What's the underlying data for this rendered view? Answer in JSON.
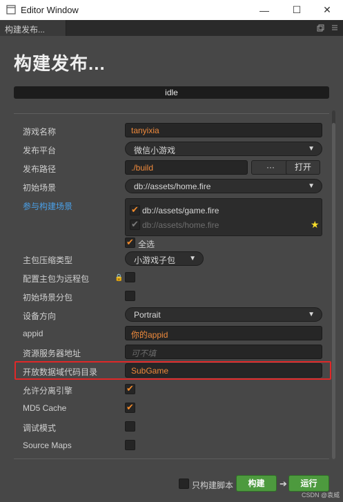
{
  "window": {
    "title": "Editor Window",
    "minimize": "—",
    "maximize": "☐",
    "close": "✕"
  },
  "tab": {
    "label": "构建发布..."
  },
  "heading": "构建发布...",
  "status": "idle",
  "form": {
    "game_name": {
      "label": "游戏名称",
      "value": "tanyixia"
    },
    "platform": {
      "label": "发布平台",
      "value": "微信小游戏"
    },
    "build_path": {
      "label": "发布路径",
      "value": "./build",
      "browse": "···",
      "open": "打开"
    },
    "start_scene": {
      "label": "初始场景",
      "value": "db://assets/home.fire"
    },
    "scenes": {
      "label": "参与构建场景",
      "items": [
        {
          "label": "db://assets/game.fire",
          "checked": true
        },
        {
          "label": "db://assets/home.fire",
          "checked": true
        }
      ],
      "select_all": "全选"
    },
    "compression": {
      "label": "主包压缩类型",
      "value": "小游戏子包"
    },
    "remote_main": {
      "label": "配置主包为远程包"
    },
    "start_scene_subpackage": {
      "label": "初始场景分包"
    },
    "orientation": {
      "label": "设备方向",
      "value": "Portrait"
    },
    "appid": {
      "label": "appid",
      "value": "你的appid"
    },
    "remote_server": {
      "label": "资源服务器地址",
      "placeholder": "可不填"
    },
    "open_data": {
      "label": "开放数据域代码目录",
      "value": "SubGame"
    },
    "separate_engine": {
      "label": "允许分离引擎"
    },
    "md5": {
      "label": "MD5 Cache"
    },
    "debug": {
      "label": "调试模式"
    },
    "source_maps": {
      "label": "Source Maps"
    }
  },
  "footer": {
    "build_script_only": "只构建脚本",
    "build": "构建",
    "run": "运行",
    "arrow": "➔"
  },
  "watermark": "CSDN @袁威",
  "colors": {
    "accent": "#ef8a3c",
    "link": "#4aa0e8",
    "green": "#4d9a3e",
    "highlight": "#e02828"
  }
}
